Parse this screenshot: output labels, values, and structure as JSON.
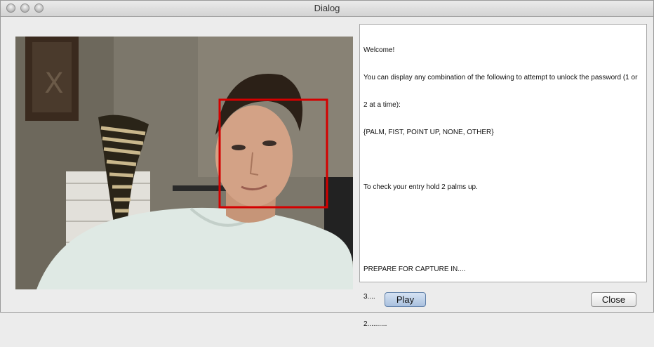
{
  "window": {
    "title": "Dialog"
  },
  "video": {
    "face_box_color": "#d40000"
  },
  "output": {
    "lines": [
      "Welcome!",
      "You can display any combination of the following to attempt to unlock the password (1 or",
      "2 at a time):",
      "{PALM, FIST, POINT UP, NONE, OTHER}",
      "",
      "To check your entry hold 2 palms up.",
      "",
      "",
      "PREPARE FOR CAPTURE IN....",
      "3....",
      "2.........."
    ]
  },
  "buttons": {
    "play_label": "Play",
    "close_label": "Close"
  }
}
